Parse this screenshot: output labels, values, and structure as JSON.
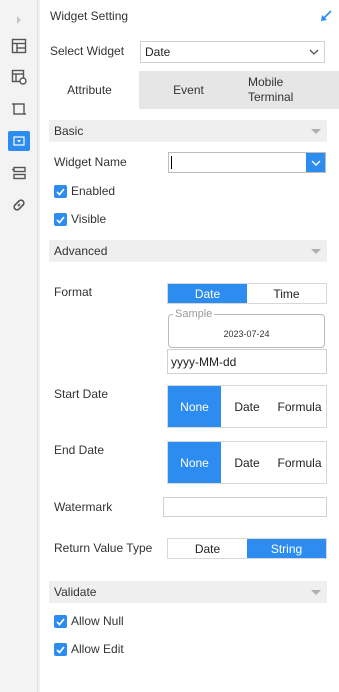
{
  "rail": {
    "items": [
      {
        "name": "expand-arrow-icon"
      },
      {
        "name": "table-layout-icon"
      },
      {
        "name": "grid-settings-icon"
      },
      {
        "name": "frame-icon"
      },
      {
        "name": "widget-dropdown-icon",
        "active": true
      },
      {
        "name": "list-settings-icon"
      },
      {
        "name": "link-icon"
      }
    ],
    "accent": "#2d8cf0"
  },
  "header": {
    "title": "Widget Setting",
    "icon": "collapse-arrow-icon"
  },
  "select_widget": {
    "label": "Select Widget",
    "value": "Date"
  },
  "tabs": [
    {
      "label": "Attribute",
      "active": true
    },
    {
      "label": "Event",
      "active": false
    },
    {
      "label": "Mobile Terminal",
      "active": false
    }
  ],
  "basic": {
    "title": "Basic",
    "widget_name_label": "Widget Name",
    "widget_name_value": "",
    "enabled_label": "Enabled",
    "enabled_checked": true,
    "visible_label": "Visible",
    "visible_checked": true
  },
  "advanced": {
    "title": "Advanced",
    "format": {
      "label": "Format",
      "options": [
        "Date",
        "Time"
      ],
      "selected": "Date"
    },
    "sample": {
      "legend": "Sample",
      "value": "2023-07-24"
    },
    "pattern": "yyyy-MM-dd",
    "start_date": {
      "label": "Start Date",
      "options": [
        "None",
        "Date",
        "Formula"
      ],
      "selected": "None"
    },
    "end_date": {
      "label": "End Date",
      "options": [
        "None",
        "Date",
        "Formula"
      ],
      "selected": "None"
    },
    "watermark": {
      "label": "Watermark",
      "value": ""
    },
    "return_value_type": {
      "label": "Return Value Type",
      "options": [
        "Date",
        "String"
      ],
      "selected": "String"
    }
  },
  "validate": {
    "title": "Validate",
    "allow_null_label": "Allow Null",
    "allow_null_checked": true,
    "allow_edit_label": "Allow Edit",
    "allow_edit_checked": true
  }
}
